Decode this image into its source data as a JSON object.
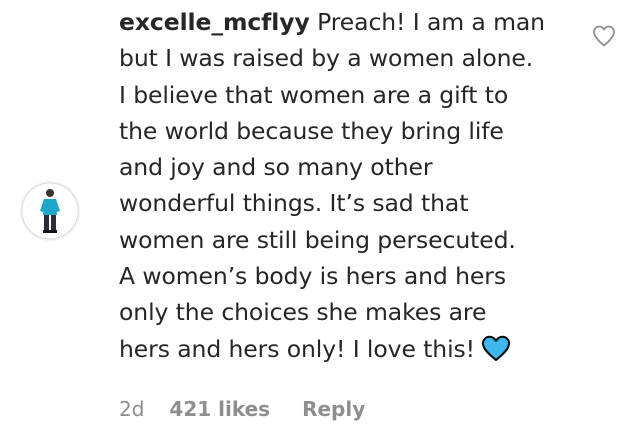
{
  "comment": {
    "username": "excelle_mcflyy",
    "lines": [
      "Preach! I am a man",
      "but I was raised by a women alone.",
      "I believe that women are a gift to",
      "the world because they bring life",
      "and joy and so many other",
      "wonderful things. It’s sad that",
      "women are still being persecuted.",
      "A women’s body is hers and hers",
      "only the choices she makes are",
      "hers and hers only! I love this!"
    ],
    "emoji": "blue-heart",
    "heart_color": "#3fb8f0",
    "time": "2d",
    "likes": "421 likes",
    "reply_label": "Reply"
  }
}
